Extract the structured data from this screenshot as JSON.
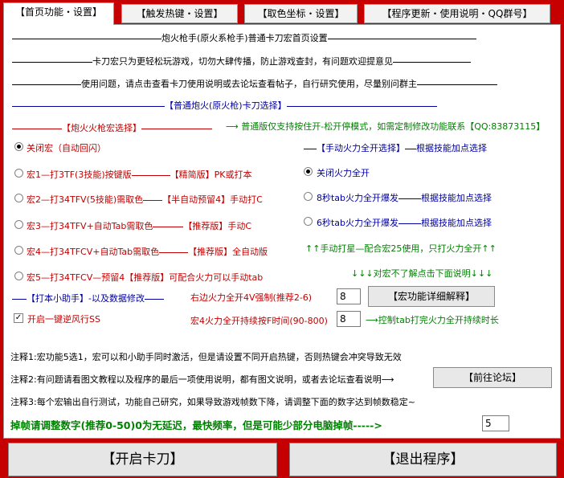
{
  "tabs": [
    {
      "label": "【首页功能・设置】"
    },
    {
      "label": "【触发热键・设置】"
    },
    {
      "label": "【取色坐标・设置】"
    },
    {
      "label": "【程序更新・使用说明・QQ群号】"
    }
  ],
  "header": {
    "title": "炮火枪手(原火系枪手)普通卡刀宏首页设置",
    "notice1": "卡刀宏只为更轻松玩游戏，切勿大肆传播，防止游戏查封，有问题欢迎提意见",
    "notice2": "使用问题，请点击查看卡刀使用说明或去论坛查看帖子，自行研究使用，尽量别问群主"
  },
  "section_title": "【普通炮火(原火枪)卡刀选择】",
  "macro_section": {
    "label": "【炮火火枪宏选择】",
    "arrow_note": "普通版仅支持按住开-松开停模式，如需定制修改功能联系【QQ:83873115】"
  },
  "macros": [
    {
      "label": "关闭宏（自动回闪）",
      "checked": true
    },
    {
      "label_a": "宏1—打3TF(3技能)按键版",
      "label_b": "【精简版】PK或打本",
      "checked": false
    },
    {
      "label_a": "宏2—打34TFV(5技能)需取色",
      "label_b": "【半自动预留4】手动打C",
      "checked": false
    },
    {
      "label_a": "宏3—打34TFV+自动Tab需取色",
      "label_b": "【推荐版】手动C",
      "checked": false
    },
    {
      "label_a": "宏4—打34TFCV+自动Tab需取色",
      "label_b": "【推荐版】全自动版",
      "checked": false
    },
    {
      "label_a": "宏5—打34TFCV—预留4【推荐版】可配合火力可以手动tab",
      "checked": false
    }
  ],
  "fire_section": {
    "label": "【手动火力全开选择】",
    "note": "根据技能加点选择",
    "options": [
      {
        "label": "关闭火力全开",
        "checked": true
      },
      {
        "label": "8秒tab火力全开爆发",
        "note": "根据技能加点选择",
        "checked": false
      },
      {
        "label": "6秒tab火力全开爆发",
        "note": "根据技能加点选择",
        "checked": false
      }
    ],
    "hint1": "↑↑手动打星—配合宏25使用，只打火力全开↑↑",
    "hint2": "↓↓↓对宏不了解点击下面说明↓↓↓"
  },
  "helper": {
    "label": "【打本小助手】-以及数据修改",
    "checkbox_label": "开启一键逆风行SS",
    "checkbox_checked": true,
    "force_label": "右边火力全开4V强制(推荐2-6)",
    "force_value": "8",
    "duration_label": "宏4火力全开持续按F时间(90-800)",
    "duration_value": "8",
    "duration_hint": "控制tab打完火力全开持续时长",
    "explain_button": "【宏功能详细解释】"
  },
  "notes": {
    "note1": "注释1:宏功能5选1，宏可以和小助手同时激活，但是请设置不同开启热键，否则热键会冲突导致无效",
    "note2": "注释2:有问题请看图文教程以及程序的最后一项使用说明，都有图文说明，或者去论坛查看说明",
    "forum_button": "【前往论坛】",
    "note3": "注释3:每个宏输出自行测试，功能自己研究，如果导致游戏帧数下降，请调整下面的数字达到帧数稳定~"
  },
  "frame": {
    "label": "掉帧请调整数字(推荐0-50)0为无延迟，最快频率，但是可能少部分电脑掉帧",
    "arrow": "----->",
    "value": "5"
  },
  "buttons": {
    "start": "【开启卡刀】",
    "exit": "【退出程序】"
  }
}
